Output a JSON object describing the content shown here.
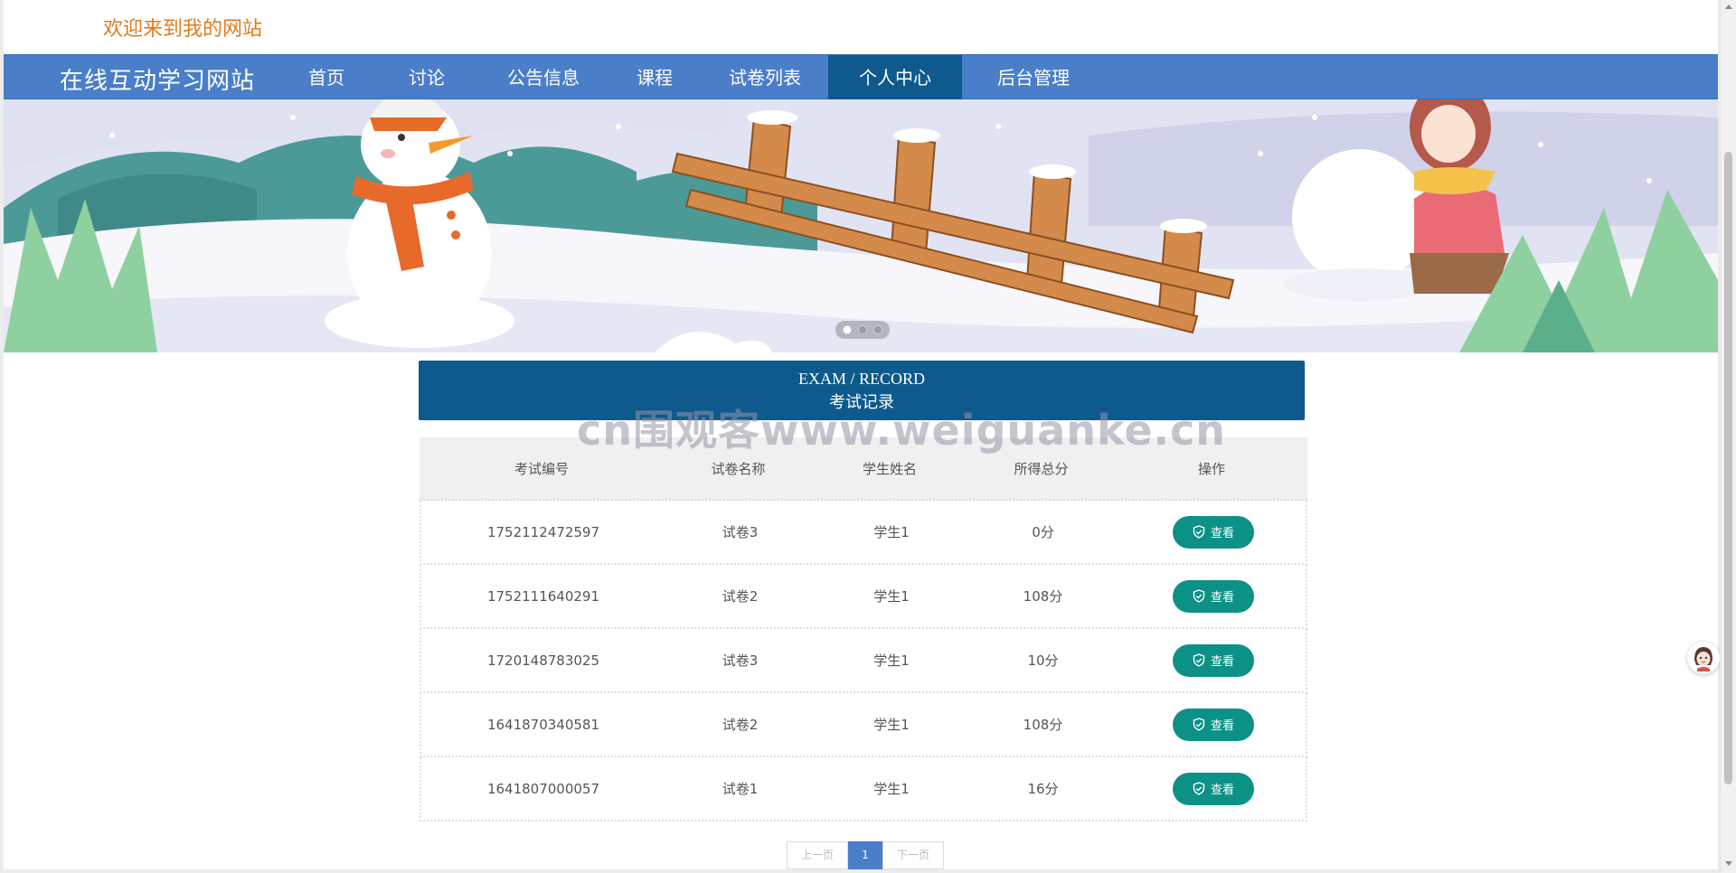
{
  "header": {
    "welcome_text": "欢迎来到我的网站"
  },
  "nav": {
    "brand": "在线互动学习网站",
    "items": [
      {
        "label": "首页"
      },
      {
        "label": "讨论"
      },
      {
        "label": "公告信息"
      },
      {
        "label": "课程"
      },
      {
        "label": "试卷列表"
      },
      {
        "label": "个人中心",
        "active": true
      },
      {
        "label": "后台管理"
      }
    ],
    "color": "#4a7ec9",
    "active_color": "#0e5a8c"
  },
  "banner": {
    "carousel_dots": 3,
    "active_dot": 1
  },
  "record": {
    "title_en": "EXAM / RECORD",
    "title_cn": "考试记录",
    "watermark": "cn围观客www.weiguanke.cn",
    "columns": [
      "考试编号",
      "试卷名称",
      "学生姓名",
      "所得总分",
      "操作"
    ],
    "rows": [
      {
        "id": "1752112472597",
        "paper": "试卷3",
        "student": "学生1",
        "score": "0分",
        "action": "查看"
      },
      {
        "id": "1752111640291",
        "paper": "试卷2",
        "student": "学生1",
        "score": "108分",
        "action": "查看"
      },
      {
        "id": "1720148783025",
        "paper": "试卷3",
        "student": "学生1",
        "score": "10分",
        "action": "查看"
      },
      {
        "id": "1641870340581",
        "paper": "试卷2",
        "student": "学生1",
        "score": "108分",
        "action": "查看"
      },
      {
        "id": "1641807000057",
        "paper": "试卷1",
        "student": "学生1",
        "score": "16分",
        "action": "查看"
      }
    ],
    "button_color": "#0c9186"
  },
  "pagination": {
    "prev": "上一页",
    "current": "1",
    "next": "下一页"
  },
  "icons": {
    "view": "shield-check-icon",
    "floating": "avatar-icon"
  }
}
